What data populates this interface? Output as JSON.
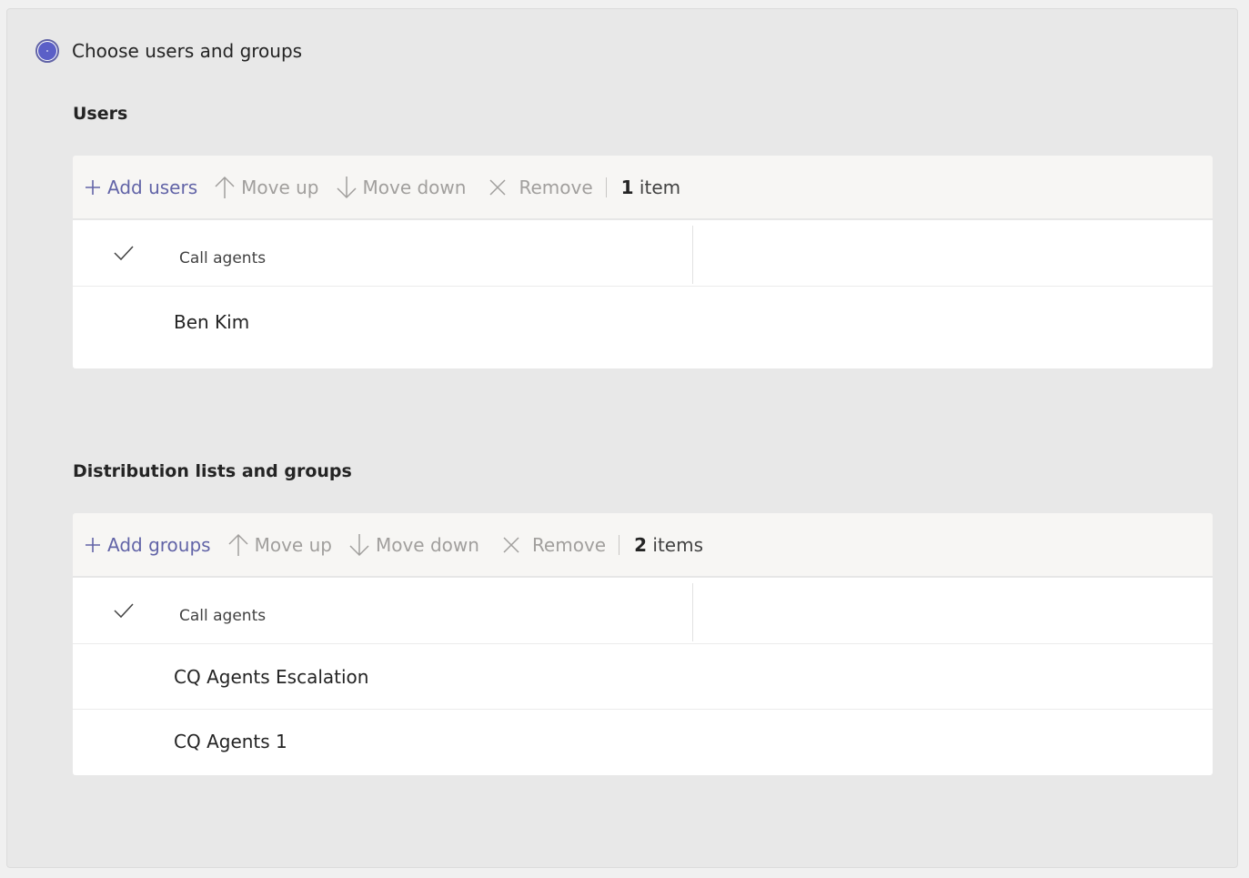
{
  "choice": {
    "label": "Choose users and groups",
    "selected": true
  },
  "users": {
    "title": "Users",
    "toolbar": {
      "add_label": "Add users",
      "move_up_label": "Move up",
      "move_down_label": "Move down",
      "remove_label": "Remove",
      "count_number": "1",
      "count_unit": "item"
    },
    "column_header": "Call agents",
    "rows": [
      "Ben Kim"
    ]
  },
  "groups": {
    "title": "Distribution lists and groups",
    "toolbar": {
      "add_label": "Add groups",
      "move_up_label": "Move up",
      "move_down_label": "Move down",
      "remove_label": "Remove",
      "count_number": "2",
      "count_unit": "items"
    },
    "column_header": "Call agents",
    "rows": [
      "CQ Agents Escalation",
      "CQ Agents 1"
    ]
  },
  "colors": {
    "accent": "#6264a7",
    "disabled": "#a19f9d"
  },
  "icons": {
    "radio": "radio-selected-icon",
    "add": "plus-icon",
    "move_up": "arrow-up-icon",
    "move_down": "arrow-down-icon",
    "remove": "close-icon",
    "select_all": "checkmark-icon"
  }
}
